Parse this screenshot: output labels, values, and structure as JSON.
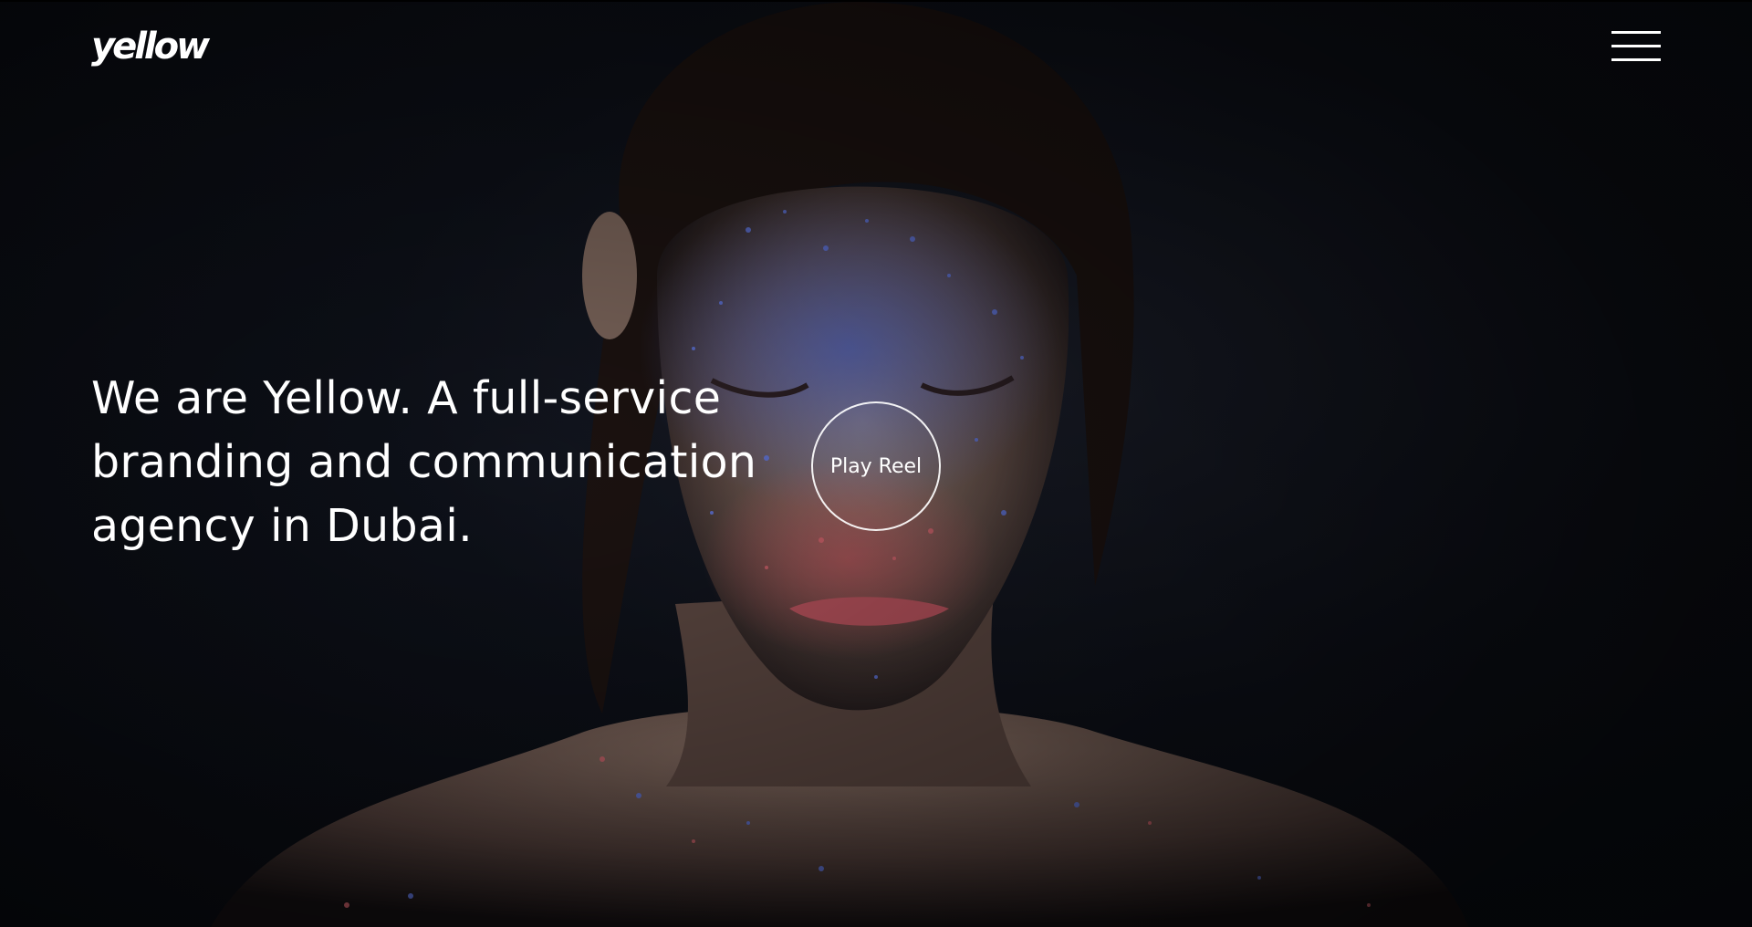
{
  "header": {
    "logo_text": "yellow",
    "menu_icon": "hamburger-menu-icon"
  },
  "hero": {
    "headline_lines": [
      "We are Yellow. A full-service",
      "branding and communication",
      "agency in Dubai."
    ],
    "play_reel_label": "Play Reel"
  },
  "colors": {
    "background": "#0b0e16",
    "text": "#ffffff",
    "accent_blue": "#4a5fc0",
    "accent_red": "#c8505a"
  }
}
